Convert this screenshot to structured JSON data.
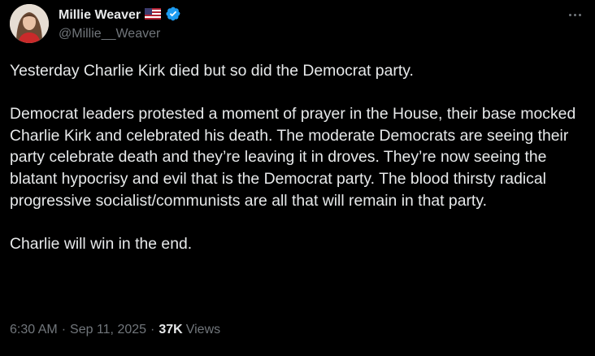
{
  "author": {
    "display_name": "Millie Weaver",
    "handle": "@Millie__Weaver",
    "flag_icon": "us-flag-icon",
    "verified_icon": "verified-badge-icon"
  },
  "post": {
    "paragraphs": [
      "Yesterday Charlie Kirk died but so did the Democrat party.",
      "Democrat leaders protested a moment of prayer in the House, their base mocked Charlie Kirk and celebrated his death. The moderate Democrats are seeing their party celebrate death and they’re leaving it in droves. They’re now seeing the blatant hypocrisy and evil that is the Democrat party. The blood thirsty radical progressive socialist/communists are all that will remain in that party.",
      "Charlie will win in the end."
    ]
  },
  "meta": {
    "time": "6:30 AM",
    "separator": "·",
    "date": "Sep 11, 2025",
    "views_count": "37K",
    "views_label": "Views"
  },
  "colors": {
    "background": "#000000",
    "text": "#e7e9ea",
    "muted": "#71767b",
    "verified": "#1d9bf0"
  }
}
